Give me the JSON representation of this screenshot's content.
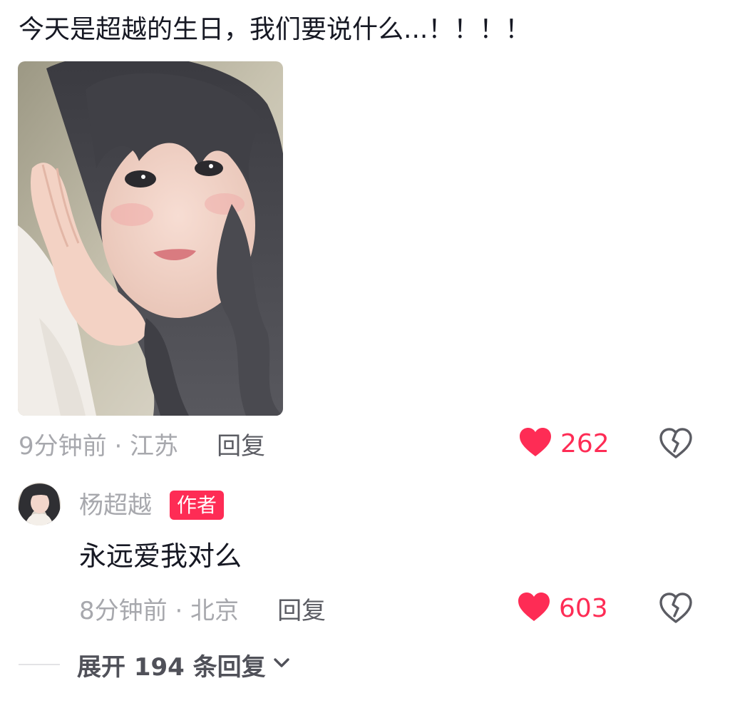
{
  "comment": {
    "text": "今天是超越的生日，我们要说什么...！！！！",
    "image": {
      "kind": "selfie-photo"
    },
    "time_location": "9分钟前 · 江苏",
    "reply_label": "回复",
    "likes": "262"
  },
  "reply": {
    "author": "杨超越",
    "badge": "作者",
    "text": "永远爱我对么",
    "time_location": "8分钟前 · 北京",
    "reply_label": "回复",
    "likes": "603"
  },
  "expand": {
    "label": "展开 194 条回复"
  },
  "icons": {
    "like": "heart-filled-icon",
    "dislike": "broken-heart-icon",
    "expand": "chevron-down-icon"
  },
  "colors": {
    "like": "#fe2c55",
    "badge": "#fe2c55",
    "meta": "#a7a8ad",
    "text": "#161823",
    "icon_gray": "#5b5c63"
  }
}
